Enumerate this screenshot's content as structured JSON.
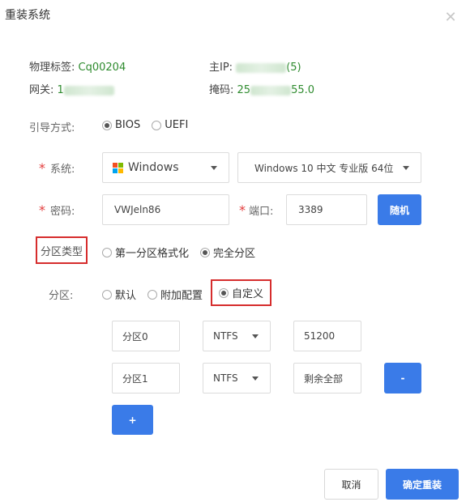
{
  "dialog": {
    "title": "重装系统"
  },
  "info": {
    "asset_label": "物理标签:",
    "asset_value": "Cq00204",
    "ip_label": "主IP:",
    "ip_suffix": "(5)",
    "gateway_label": "网关:",
    "gateway_prefix": "1",
    "mask_label": "掩码:",
    "mask_prefix": "25",
    "mask_suffix": "55.0"
  },
  "boot": {
    "label": "引导方式:",
    "options": [
      "BIOS",
      "UEFI"
    ],
    "selected": "BIOS"
  },
  "system": {
    "label": "系统:",
    "os_family": "Windows",
    "os_version": "Windows 10 中文 专业版 64位"
  },
  "password": {
    "label": "密码:",
    "value": "VWJeln86"
  },
  "port": {
    "label": "端口:",
    "value": "3389"
  },
  "random_button": "随机",
  "partition_type": {
    "label": "分区类型",
    "options": [
      "第一分区格式化",
      "完全分区"
    ],
    "selected": "完全分区"
  },
  "partition": {
    "label": "分区:",
    "options": [
      "默认",
      "附加配置",
      "自定义"
    ],
    "selected": "自定义"
  },
  "partitions": [
    {
      "name": "分区0",
      "fs": "NTFS",
      "size": "51200"
    },
    {
      "name": "分区1",
      "fs": "NTFS",
      "size": "剩余全部"
    }
  ],
  "remove_button": "-",
  "add_button": "+",
  "footer": {
    "cancel": "取消",
    "confirm": "确定重装"
  },
  "colors": {
    "accent": "#3a7be8",
    "highlight": "#d62d2d",
    "info_value": "#2e8b2e"
  }
}
